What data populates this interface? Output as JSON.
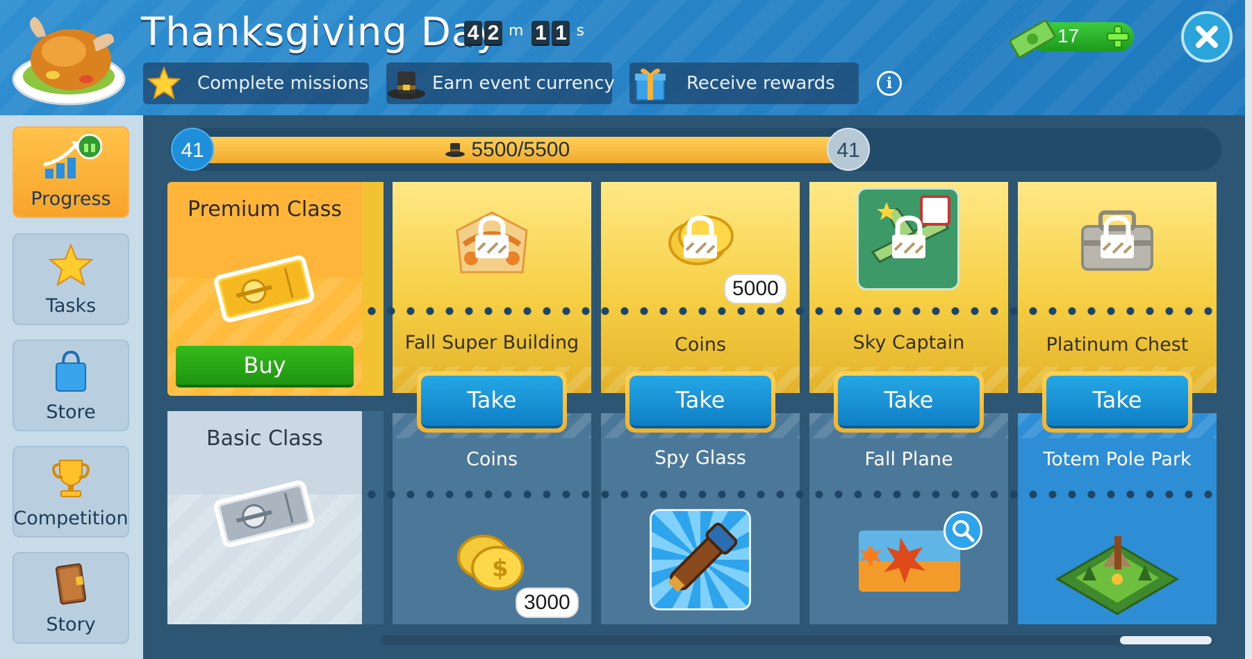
{
  "header": {
    "title": "Thanksgiving Day",
    "timer": {
      "minutes": [
        "4",
        "2"
      ],
      "minutes_unit": "m",
      "seconds": [
        "1",
        "1"
      ],
      "seconds_unit": "s"
    },
    "steps": [
      {
        "label": "Complete missions",
        "icon": "star-icon"
      },
      {
        "label": "Earn event currency",
        "icon": "pilgrim-hat-icon"
      },
      {
        "label": "Receive rewards",
        "icon": "gift-icon"
      }
    ],
    "info_label": "i",
    "currency": {
      "value": "17",
      "icon": "cash-icon"
    }
  },
  "sidebar": {
    "items": [
      {
        "label": "Progress",
        "icon": "progress-chart-icon",
        "active": true
      },
      {
        "label": "Tasks",
        "icon": "star-icon"
      },
      {
        "label": "Store",
        "icon": "shopping-bag-icon"
      },
      {
        "label": "Competition",
        "icon": "trophy-icon"
      },
      {
        "label": "Story",
        "icon": "book-icon"
      }
    ]
  },
  "progress": {
    "level_left": "41",
    "level_right": "41",
    "text": "5500/5500",
    "fraction": 1.0
  },
  "classes": {
    "premium": {
      "title": "Premium Class",
      "buy_label": "Buy"
    },
    "basic": {
      "title": "Basic Class"
    }
  },
  "rewards": [
    {
      "premium": {
        "label": "Fall Super Building",
        "locked": true,
        "qty": ""
      },
      "take_label": "Take",
      "basic": {
        "label": "Coins",
        "qty": "3000"
      }
    },
    {
      "premium": {
        "label": "Coins",
        "locked": true,
        "qty": "5000"
      },
      "take_label": "Take",
      "basic": {
        "label": "Spy Glass",
        "qty": ""
      }
    },
    {
      "premium": {
        "label": "Sky Captain",
        "locked": true,
        "qty": ""
      },
      "take_label": "Take",
      "basic": {
        "label": "Fall Plane",
        "qty": ""
      }
    },
    {
      "premium": {
        "label": "Platinum Chest",
        "locked": true,
        "qty": ""
      },
      "take_label": "Take",
      "basic": {
        "label": "Totem Pole Park",
        "qty": ""
      }
    }
  ],
  "colors": {
    "accent_orange": "#ffb43a",
    "take_blue": "#1a93d8",
    "buy_green": "#2aa818",
    "header_blue": "#2a86c8"
  }
}
